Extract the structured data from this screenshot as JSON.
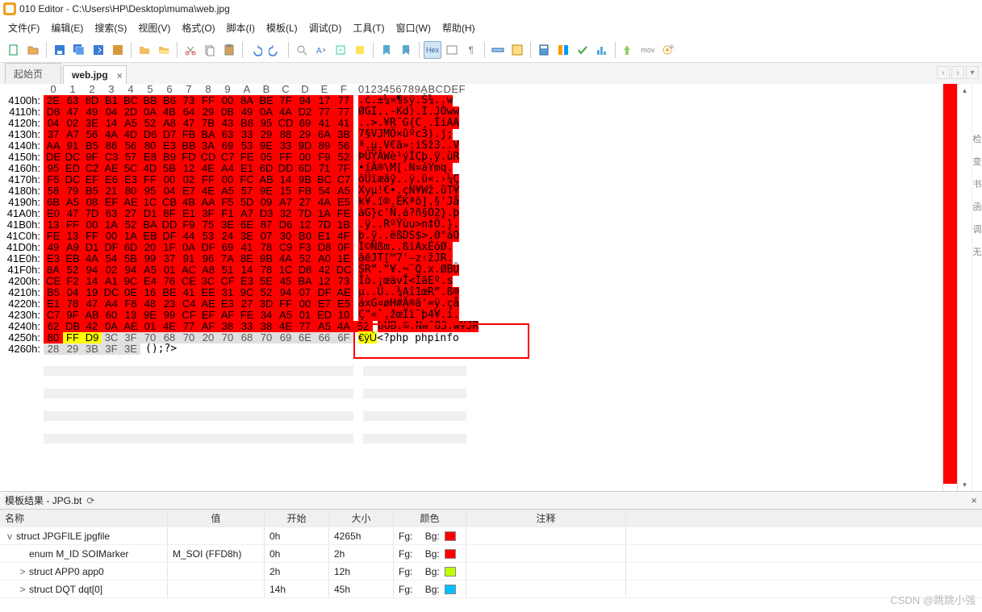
{
  "title": "010 Editor - C:\\Users\\HP\\Desktop\\muma\\web.jpg",
  "menu": [
    "文件(F)",
    "编辑(E)",
    "搜索(S)",
    "视图(V)",
    "格式(O)",
    "脚本(I)",
    "模板(L)",
    "调试(D)",
    "工具(T)",
    "窗口(W)",
    "帮助(H)"
  ],
  "tabs": {
    "start": "起始页",
    "active": "web.jpg"
  },
  "hex": {
    "col_hdr": [
      "0",
      "1",
      "2",
      "3",
      "4",
      "5",
      "6",
      "7",
      "8",
      "9",
      "A",
      "B",
      "C",
      "D",
      "E",
      "F"
    ],
    "ascii_hdr": "0123456789ABCDEF",
    "rows": [
      {
        "a": "4100h:",
        "h": [
          "2E",
          "63",
          "8D",
          "B1",
          "BC",
          "BB",
          "B6",
          "73",
          "FF",
          "00",
          "8A",
          "BE",
          "7F",
          "94",
          "17",
          "77"
        ],
        "t": ".c.±¼»¶sÿ.Š¾..w",
        "style": "red"
      },
      {
        "a": "4110h:",
        "h": [
          "D8",
          "47",
          "49",
          "04",
          "2D",
          "0A",
          "4B",
          "64",
          "29",
          "0B",
          "49",
          "0A",
          "4A",
          "D2",
          "77",
          "77"
        ],
        "t": "ØGI..-Kd).I.JÒww",
        "style": "red"
      },
      {
        "a": "4120h:",
        "h": [
          "04",
          "02",
          "3E",
          "14",
          "A5",
          "52",
          "A8",
          "47",
          "7B",
          "43",
          "B8",
          "95",
          "CD",
          "69",
          "41",
          "41"
        ],
        "t": "..>.¥R¨G{C¸.ÍiAA",
        "style": "red"
      },
      {
        "a": "4130h:",
        "h": [
          "37",
          "A7",
          "56",
          "4A",
          "4D",
          "D6",
          "D7",
          "FB",
          "BA",
          "63",
          "33",
          "29",
          "88",
          "29",
          "6A",
          "3B"
        ],
        "t": "7§VJMÖ×ûºc3).j;",
        "style": "red"
      },
      {
        "a": "4140h:",
        "h": [
          "AA",
          "91",
          "B5",
          "86",
          "56",
          "80",
          "E3",
          "BB",
          "3A",
          "69",
          "53",
          "9E",
          "33",
          "9D",
          "89",
          "56"
        ],
        "t": "ª.µ.V€ã»:iSž3..V",
        "style": "red"
      },
      {
        "a": "4150h:",
        "h": [
          "DE",
          "DC",
          "9F",
          "C3",
          "57",
          "E8",
          "B9",
          "FD",
          "CD",
          "C7",
          "FE",
          "05",
          "FF",
          "00",
          "F9",
          "52"
        ],
        "t": "ÞÜŸÃWè¹ýÍÇþ.ÿ.ùR",
        "style": "red"
      },
      {
        "a": "4160h:",
        "h": [
          "95",
          "ED",
          "C2",
          "AE",
          "5C",
          "4D",
          "5B",
          "12",
          "4E",
          "A4",
          "E1",
          "6D",
          "DD",
          "6D",
          "71",
          "7F"
        ],
        "t": "•íÂ®\\M[.N¤áÝmq.",
        "style": "red"
      },
      {
        "a": "4170h:",
        "h": [
          "F5",
          "DC",
          "EF",
          "E6",
          "E3",
          "FF",
          "00",
          "02",
          "FF",
          "00",
          "FC",
          "AB",
          "14",
          "9B",
          "BC",
          "C7"
        ],
        "t": "õÜïæãÿ..ÿ.ü«.›¼Ç",
        "style": "red"
      },
      {
        "a": "4180h:",
        "h": [
          "58",
          "79",
          "B5",
          "21",
          "80",
          "95",
          "04",
          "E7",
          "4E",
          "A5",
          "57",
          "9E",
          "15",
          "FB",
          "54",
          "A5"
        ],
        "t": "Xyµ!€•.çN¥Wž.ûT¥",
        "style": "red"
      },
      {
        "a": "4190h:",
        "h": [
          "6B",
          "A5",
          "08",
          "EF",
          "AE",
          "1C",
          "CB",
          "4B",
          "AA",
          "F5",
          "5D",
          "09",
          "A7",
          "27",
          "4A",
          "E5"
        ],
        "t": "k¥.ï®.ËKªõ].§'Jå",
        "style": "red"
      },
      {
        "a": "41A0h:",
        "h": [
          "E0",
          "47",
          "7D",
          "63",
          "27",
          "D1",
          "8F",
          "E1",
          "3F",
          "F1",
          "A7",
          "D3",
          "32",
          "7D",
          "1A",
          "FE"
        ],
        "t": "àG}c'Ñ.á?ñ§Ó2}.þ",
        "style": "red"
      },
      {
        "a": "41B0h:",
        "h": [
          "13",
          "FF",
          "00",
          "1A",
          "52",
          "BA",
          "DD",
          "F9",
          "75",
          "3E",
          "6E",
          "87",
          "D6",
          "12",
          "7D",
          "1B"
        ],
        "t": ".ÿ..RºÝùu>n‡Ö.}.",
        "style": "red"
      },
      {
        "a": "41C0h:",
        "h": [
          "FE",
          "13",
          "FF",
          "00",
          "1A",
          "EB",
          "DF",
          "44",
          "53",
          "24",
          "3E",
          "07",
          "30",
          "B0",
          "E1",
          "4F"
        ],
        "t": "þ.ÿ..ëßDS$>.0°áO",
        "style": "red"
      },
      {
        "a": "41D0h:",
        "h": [
          "49",
          "A9",
          "D1",
          "DF",
          "6D",
          "20",
          "1F",
          "0A",
          "DF",
          "69",
          "41",
          "78",
          "C9",
          "F3",
          "D8",
          "0F"
        ],
        "t": "I©Ñßm..ßiAxÉóØ.",
        "style": "red"
      },
      {
        "a": "41E0h:",
        "h": [
          "E3",
          "EB",
          "4A",
          "54",
          "5B",
          "99",
          "37",
          "91",
          "96",
          "7A",
          "8E",
          "9B",
          "4A",
          "52",
          "A0",
          "1E"
        ],
        "t": "ãëJT[™7'–z‹žJR.",
        "style": "red"
      },
      {
        "a": "41F0h:",
        "h": [
          "8A",
          "52",
          "94",
          "02",
          "94",
          "A5",
          "01",
          "AC",
          "A8",
          "51",
          "14",
          "78",
          "1C",
          "D8",
          "42",
          "DC"
        ],
        "t": "ŠR”.”¥.¬¨Q.x.ØBÜ",
        "style": "red"
      },
      {
        "a": "4200h:",
        "h": [
          "CE",
          "F2",
          "14",
          "A1",
          "9C",
          "E4",
          "76",
          "CE",
          "3C",
          "CF",
          "E3",
          "5E",
          "45",
          "BA",
          "12",
          "73"
        ],
        "t": "Îò.¡œävÎ<ÏãEº.s",
        "style": "red"
      },
      {
        "a": "4210h:",
        "h": [
          "B5",
          "04",
          "19",
          "DC",
          "0E",
          "16",
          "BE",
          "41",
          "EE",
          "31",
          "9C",
          "52",
          "94",
          "07",
          "DF",
          "AE"
        ],
        "t": "µ..Ü..¾Aî1œR”.ß®",
        "style": "red"
      },
      {
        "a": "4220h:",
        "h": [
          "E1",
          "78",
          "47",
          "A4",
          "F8",
          "48",
          "23",
          "C4",
          "AE",
          "E3",
          "27",
          "3D",
          "FF",
          "00",
          "E7",
          "E5"
        ],
        "t": "áxG¤øH#Ä®ã'=ÿ.çå",
        "style": "red"
      },
      {
        "a": "4230h:",
        "h": [
          "C7",
          "9F",
          "AB",
          "60",
          "13",
          "9E",
          "99",
          "CF",
          "EF",
          "AF",
          "FE",
          "34",
          "A5",
          "01",
          "ED",
          "10"
        ],
        "t": "Ç\"«`.žœÏï¯þ4¥.í.",
        "style": "red"
      },
      {
        "a": "4240h:",
        "h": [
          "62",
          "DB",
          "42",
          "0A",
          "AE",
          "01",
          "4E",
          "77",
          "AF",
          "38",
          "33",
          "38",
          "4E",
          "77",
          "A5",
          "4A",
          "52"
        ],
        "t": "bÛB.®.Nw¯83.w¥JR",
        "style": "red"
      },
      {
        "a": "4250h:",
        "h": [
          "80",
          "FF",
          "D9",
          "3C",
          "3F",
          "70",
          "68",
          "70",
          "20",
          "70",
          "68",
          "70",
          "69",
          "6E",
          "66",
          "6F"
        ],
        "t": "€ÿÙ<?php phpinfo",
        "style": "mixed"
      },
      {
        "a": "4260h:",
        "h": [
          "28",
          "29",
          "3B",
          "3F",
          "3E"
        ],
        "t": "();?>",
        "style": "gray"
      }
    ]
  },
  "template": {
    "title": "模板结果 - JPG.bt",
    "headers": {
      "name": "名称",
      "value": "值",
      "start": "开始",
      "size": "大小",
      "color": "颜色",
      "comment": "注释"
    },
    "fgbg": {
      "fg": "Fg:",
      "bg": "Bg:"
    },
    "rows": [
      {
        "exp": "v",
        "name": "struct JPGFILE jpgfile",
        "val": "",
        "start": "0h",
        "size": "4265h",
        "bg": "#ff0000"
      },
      {
        "exp": "",
        "name": "enum M_ID SOIMarker",
        "val": "M_SOI (FFD8h)",
        "start": "0h",
        "size": "2h",
        "bg": "#ff0000",
        "indent": 1
      },
      {
        "exp": ">",
        "name": "struct APP0 app0",
        "val": "",
        "start": "2h",
        "size": "12h",
        "bg": "#c0ff00",
        "indent": 1
      },
      {
        "exp": ">",
        "name": "struct DQT dqt[0]",
        "val": "",
        "start": "14h",
        "size": "45h",
        "bg": "#00c0ff",
        "indent": 1
      }
    ]
  },
  "watermark": "CSDN @跳跳小强"
}
